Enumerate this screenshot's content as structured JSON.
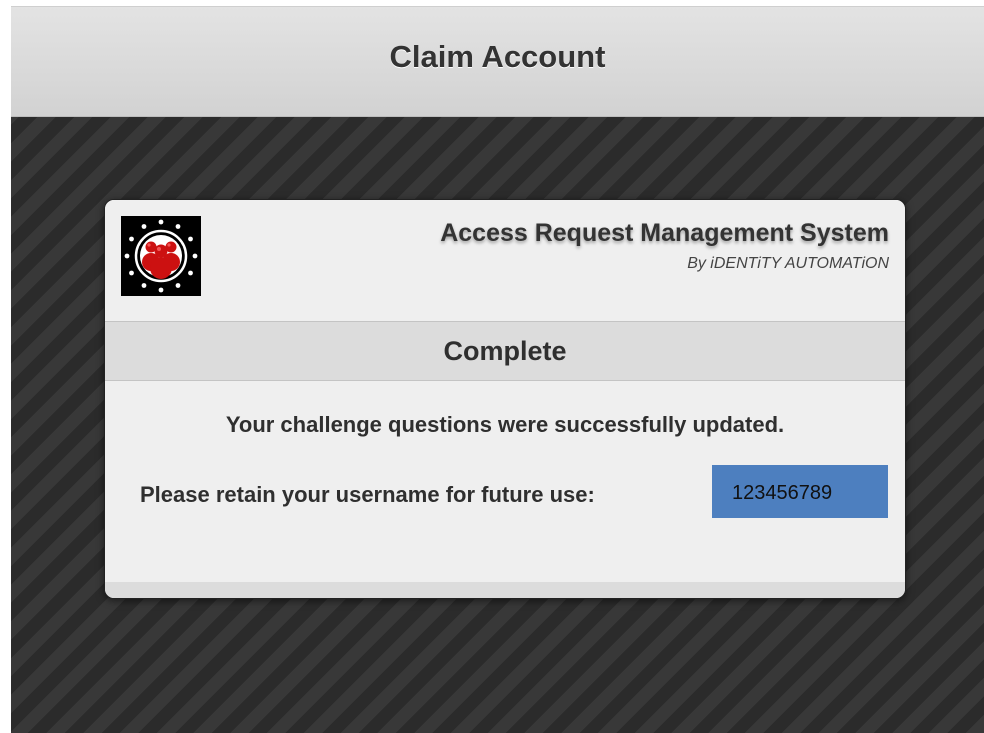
{
  "header": {
    "title": "Claim Account"
  },
  "app": {
    "name": "Access Request Management System",
    "by": "By iDENTiTY AUTOMATiON",
    "logo_icon": "people-group-logo-icon"
  },
  "section": {
    "title": "Complete"
  },
  "content": {
    "message": "Your challenge questions were successfully updated.",
    "retain_label": "Please retain your username for future use:",
    "username": "123456789"
  },
  "colors": {
    "header_bg": "#d8d8d8",
    "username_bg": "#4d7fbf",
    "background_stripes": "#2d2d2d",
    "logo_red": "#cc1111"
  }
}
